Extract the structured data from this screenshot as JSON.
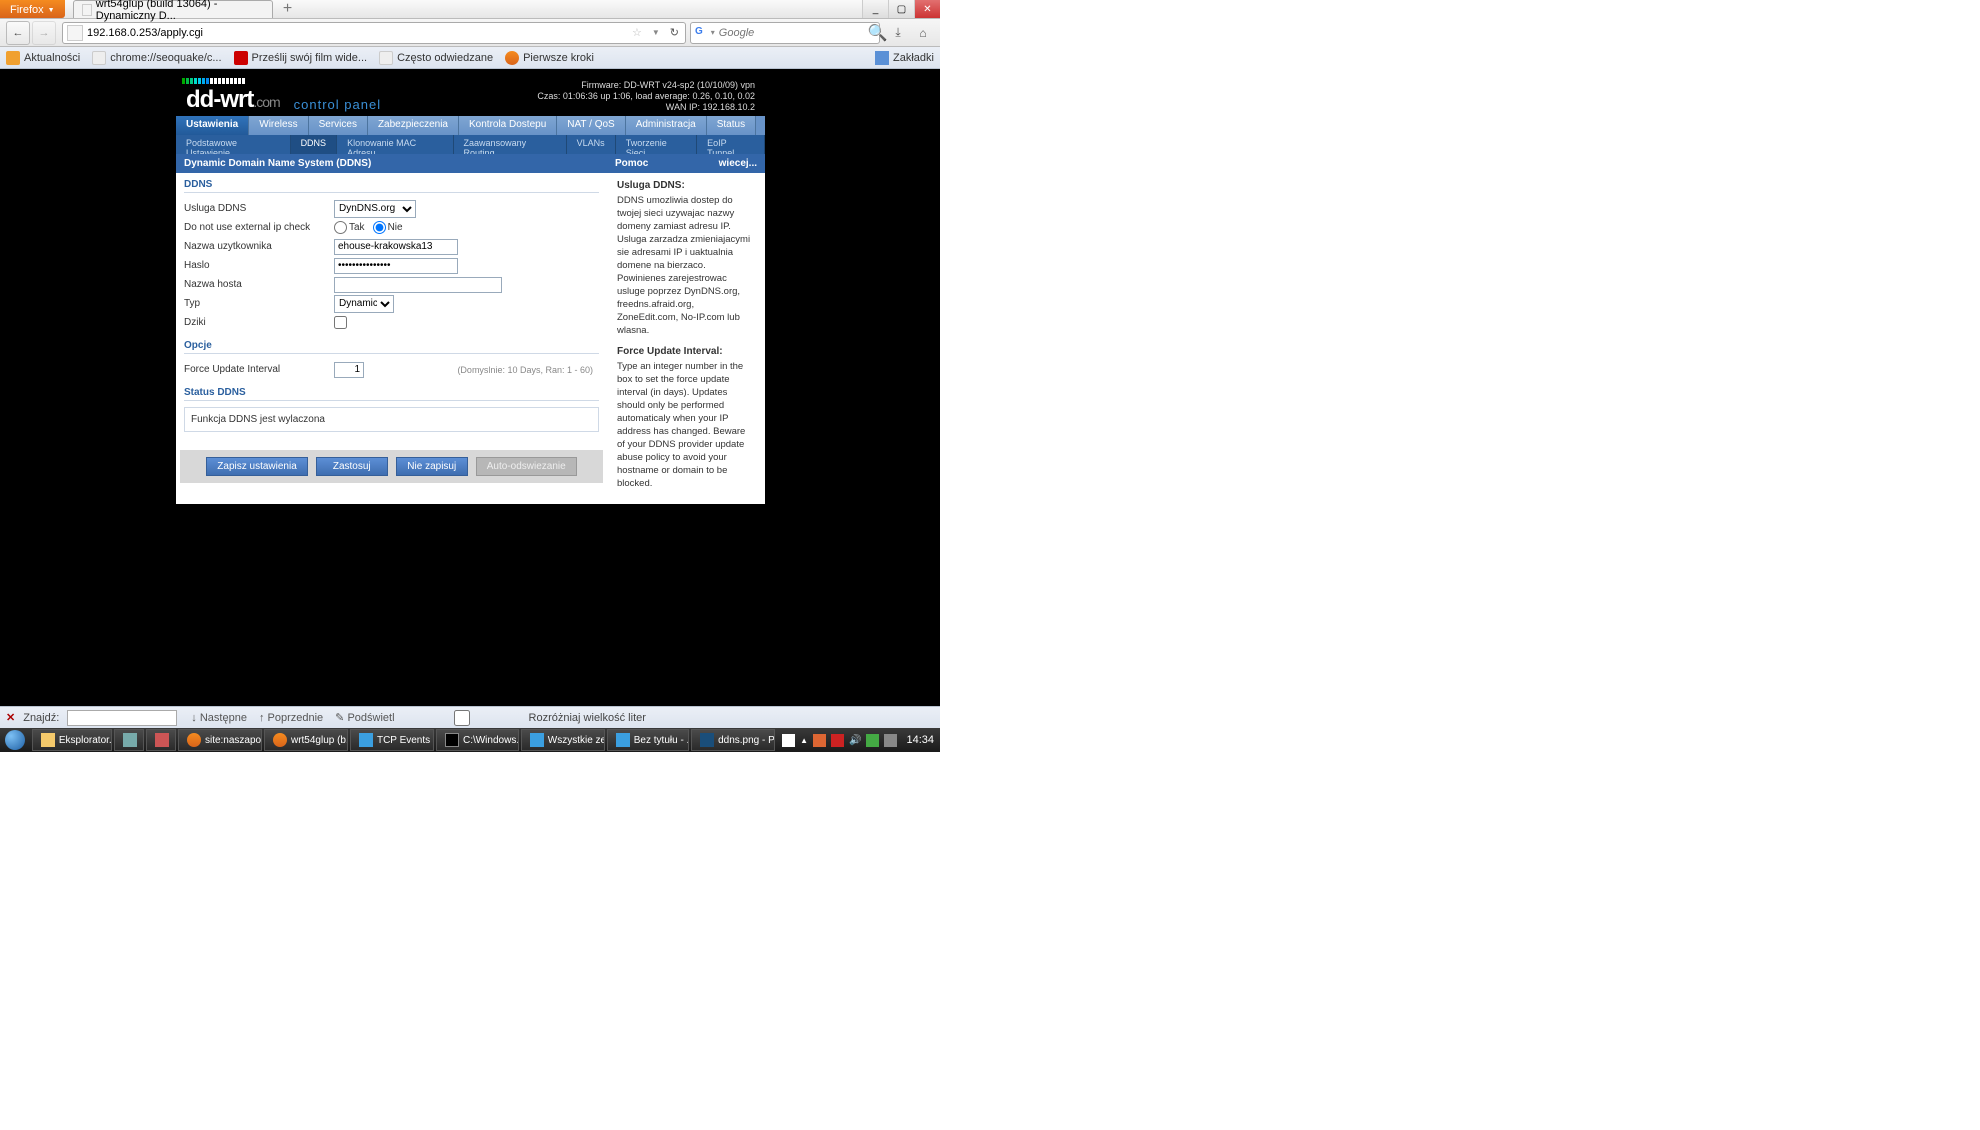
{
  "firefox": {
    "menu_label": "Firefox",
    "tab_title": "wrt54glup (build 13064) - Dynamiczny D...",
    "win": {
      "min": "_",
      "max": "▢",
      "close": "✕"
    }
  },
  "nav": {
    "url": "192.168.0.253/apply.cgi",
    "search_placeholder": "Google"
  },
  "bookmarks": {
    "items": [
      "Aktualności",
      "chrome://seoquake/c...",
      "Prześlij swój film wide...",
      "Często odwiedzane",
      "Pierwsze kroki"
    ],
    "right": "Zakładki"
  },
  "router": {
    "brand_main": "dd-wrt",
    "brand_com": ".com",
    "cpanel": "control panel",
    "info_lines": [
      "Firmware: DD-WRT v24-sp2 (10/10/09) vpn",
      "Czas: 01:06:36 up 1:06, load average: 0.26, 0.10, 0.02",
      "WAN IP: 192.168.10.2"
    ],
    "tabs": [
      "Ustawienia",
      "Wireless",
      "Services",
      "Zabezpieczenia",
      "Kontrola Dostepu",
      "NAT / QoS",
      "Administracja",
      "Status"
    ],
    "active_tab": 0,
    "subtabs": [
      "Podstawowe Ustawienie",
      "DDNS",
      "Klonowanie MAC Adresu",
      "Zaawansowany Routing",
      "VLANs",
      "Tworzenie Sieci",
      "EoIP Tunnel"
    ],
    "active_sub": 1,
    "section_title": "Dynamic Domain Name System (DDNS)",
    "ddns": {
      "legend": "DDNS",
      "service_label": "Usluga DDNS",
      "service_value": "DynDNS.org",
      "extip_label": "Do not use external ip check",
      "yes": "Tak",
      "no": "Nie",
      "user_label": "Nazwa uzytkownika",
      "user_value": "ehouse-krakowska13",
      "pass_label": "Haslo",
      "pass_value": "•••••••••••••••",
      "host_label": "Nazwa hosta",
      "host_value": "",
      "type_label": "Typ",
      "type_value": "Dynamiczny",
      "wild_label": "Dziki"
    },
    "opts": {
      "legend": "Opcje",
      "force_label": "Force Update Interval",
      "force_value": "1",
      "force_hint": "(Domyslnie: 10 Days, Ran: 1 - 60)"
    },
    "status": {
      "legend": "Status DDNS",
      "text": "Funkcja DDNS jest wylaczona"
    },
    "buttons": {
      "save": "Zapisz ustawienia",
      "apply": "Zastosuj",
      "cancel": "Nie zapisuj",
      "auto": "Auto-odswiezanie"
    },
    "help": {
      "title": "Pomoc",
      "more": "wiecej...",
      "h1": "Usluga DDNS:",
      "p1": "DDNS umozliwia dostep do twojej sieci uzywajac nazwy domeny zamiast adresu IP. Usluga zarzadza zmieniajacymi sie adresami IP i uaktualnia domene na bierzaco. Powinienes zarejestrowac usluge poprzez DynDNS.org, freedns.afraid.org, ZoneEdit.com, No-IP.com lub wlasna.",
      "h2": "Force Update Interval:",
      "p2": "Type an integer number in the box to set the force update interval (in days). Updates should only be performed automaticaly when your IP address has changed. Beware of your DDNS provider update abuse policy to avoid your hostname or domain to be blocked."
    }
  },
  "findbar": {
    "label": "Znajdź:",
    "next": "Następne",
    "prev": "Poprzednie",
    "highlight": "Podświetl",
    "case": "Rozróżniaj wielkość liter"
  },
  "taskbar": {
    "items": [
      "Eksplorator...",
      "",
      "",
      "site:naszapol...",
      "wrt54glup (b...",
      "TCP Events ...",
      "C:\\Windows...",
      "Wszystkie ze ...",
      "Bez tytułu - ...",
      "ddns.png - P..."
    ],
    "clock": "14:34"
  }
}
